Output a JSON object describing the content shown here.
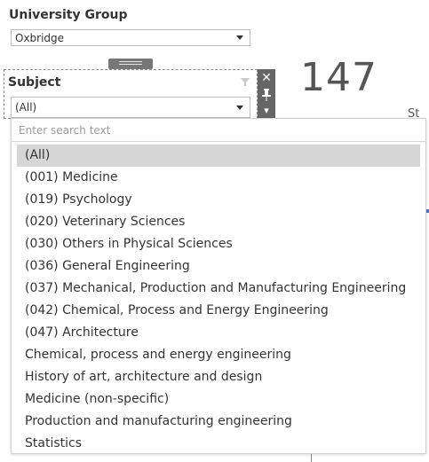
{
  "university_group": {
    "label": "University Group",
    "selected": "Oxbridge"
  },
  "kpi": {
    "value": "147",
    "caption_fragment": "St"
  },
  "subject_filter": {
    "label": "Subject",
    "selected": "(All)",
    "search_placeholder": "Enter search text",
    "options": [
      "(All)",
      "(001) Medicine",
      "(019) Psychology",
      "(020) Veterinary Sciences",
      "(030) Others in Physical Sciences",
      "(036) General Engineering",
      "(037) Mechanical, Production and Manufacturing Engineering",
      "(042) Chemical, Process and Energy Engineering",
      "(047) Architecture",
      "Chemical, process and energy engineering",
      "History of art, architecture and design",
      "Medicine (non-specific)",
      "Production and manufacturing engineering",
      "Statistics"
    ]
  },
  "toolbar": {
    "close_glyph": "✕",
    "pin_glyph": "📌",
    "more_glyph": "▾"
  },
  "colors": {
    "toolbar_bg": "#666666",
    "selected_row_bg": "#d6d6d6",
    "kpi_text": "#555555"
  }
}
